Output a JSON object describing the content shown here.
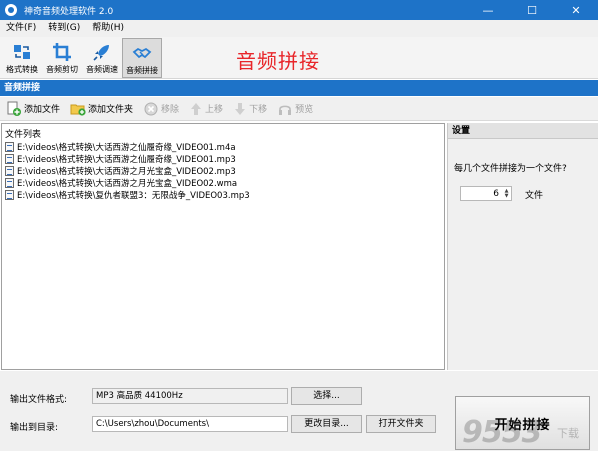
{
  "window": {
    "title": "神奇音频处理软件 2.0",
    "minimize": "—",
    "maximize": "☐",
    "close": "✕"
  },
  "menu": [
    {
      "label": "文件(F)"
    },
    {
      "label": "转到(G)"
    },
    {
      "label": "帮助(H)"
    }
  ],
  "toolbar": {
    "tools": [
      {
        "label": "格式转换",
        "icon": "convert-icon"
      },
      {
        "label": "音频剪切",
        "icon": "crop-icon"
      },
      {
        "label": "音频调速",
        "icon": "rocket-icon"
      },
      {
        "label": "音频拼接",
        "icon": "handshake-icon",
        "active": true
      }
    ],
    "banner": "音频拼接"
  },
  "section": {
    "title": "音频拼接"
  },
  "actions": [
    {
      "label": "添加文件",
      "icon": "add-file-icon",
      "enabled": true
    },
    {
      "label": "添加文件夹",
      "icon": "add-folder-icon",
      "enabled": true
    },
    {
      "label": "移除",
      "icon": "remove-icon",
      "enabled": false
    },
    {
      "label": "上移",
      "icon": "arrow-up-icon",
      "enabled": false
    },
    {
      "label": "下移",
      "icon": "arrow-down-icon",
      "enabled": false
    },
    {
      "label": "预览",
      "icon": "headphones-icon",
      "enabled": false
    }
  ],
  "filelist": {
    "header": "文件列表",
    "files": [
      "E:\\videos\\格式转换\\大话西游之仙履奇缘_VIDEO01.m4a",
      "E:\\videos\\格式转换\\大话西游之仙履奇缘_VIDEO01.mp3",
      "E:\\videos\\格式转换\\大话西游之月光宝盒_VIDEO02.mp3",
      "E:\\videos\\格式转换\\大话西游之月光宝盒_VIDEO02.wma",
      "E:\\videos\\格式转换\\复仇者联盟3：无限战争_VIDEO03.mp3"
    ]
  },
  "settings": {
    "header": "设置",
    "question": "每几个文件拼接为一个文件?",
    "count": "6",
    "unit": "文件",
    "up_arrow": "▲",
    "down_arrow": "▼"
  },
  "output": {
    "format_label": "输出文件格式:",
    "format_value": "MP3 高品质 44100Hz",
    "choose_button": "选择...",
    "dir_label": "输出到目录:",
    "dir_value": "C:\\Users\\zhou\\Documents\\",
    "change_dir_button": "更改目录...",
    "open_folder_button": "打开文件夹",
    "start_button": "开始拼接"
  },
  "watermark": {
    "text": "9553",
    "sub": "下载"
  },
  "colors": {
    "titlebar": "#1e73c8",
    "banner_text": "#e8262a"
  }
}
